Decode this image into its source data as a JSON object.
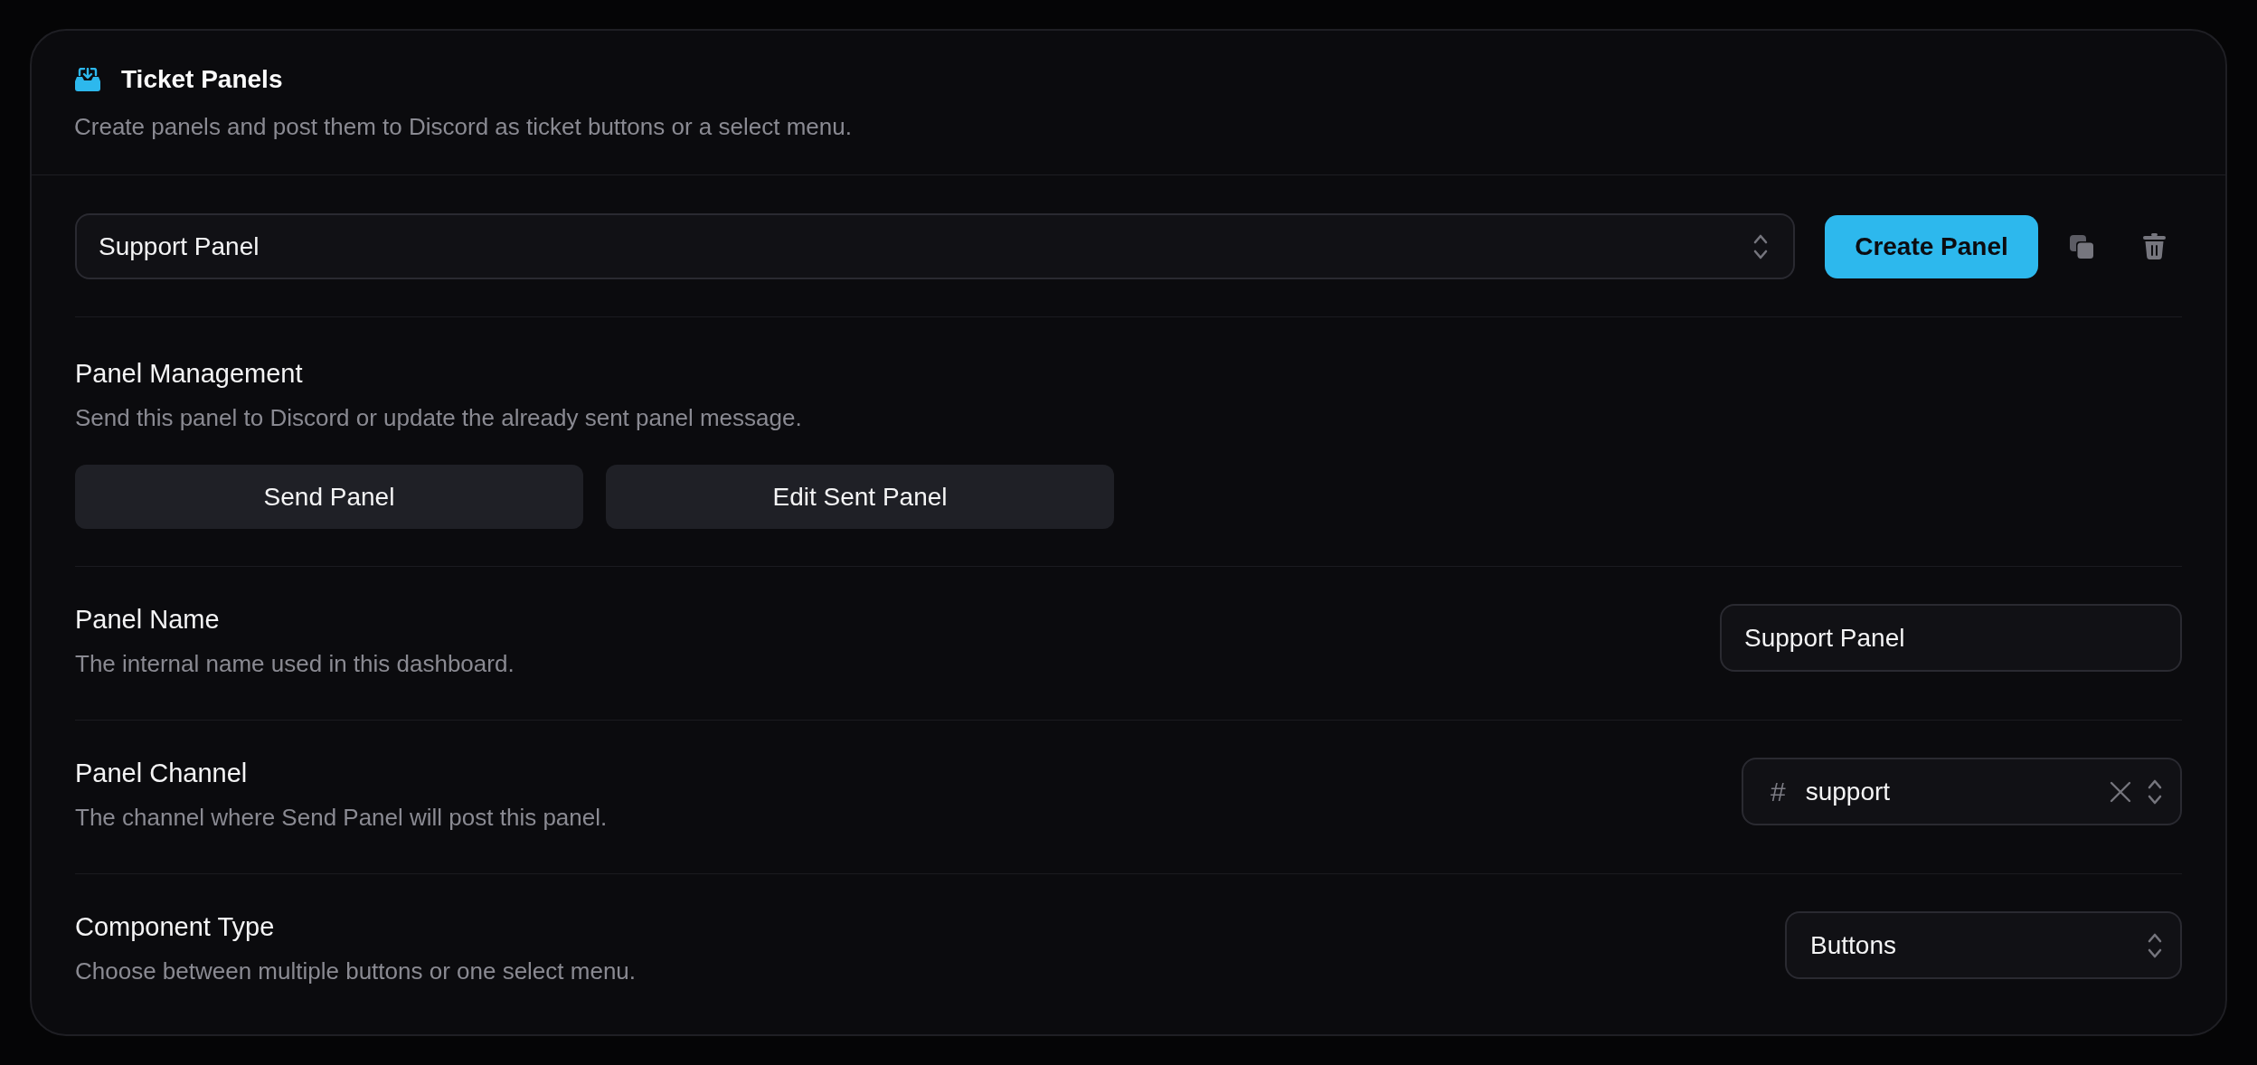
{
  "header": {
    "title": "Ticket Panels",
    "subtitle": "Create panels and post them to Discord as ticket buttons or a select menu."
  },
  "panel_selector": {
    "value": "Support Panel",
    "create_button": "Create Panel"
  },
  "management": {
    "title": "Panel Management",
    "description": "Send this panel to Discord or update the already sent panel message.",
    "buttons": [
      "Send Panel",
      "Edit Sent Panel"
    ]
  },
  "settings": [
    {
      "kind": "text",
      "title": "Panel Name",
      "description": "The internal name used in this dashboard.",
      "value": "Support Panel"
    },
    {
      "kind": "channel",
      "title": "Panel Channel",
      "description": "The channel where Send Panel will post this panel.",
      "prefix": "#",
      "value": "support"
    },
    {
      "kind": "select",
      "title": "Component Type",
      "description": "Choose between multiple buttons or one select menu.",
      "value": "Buttons"
    }
  ]
}
